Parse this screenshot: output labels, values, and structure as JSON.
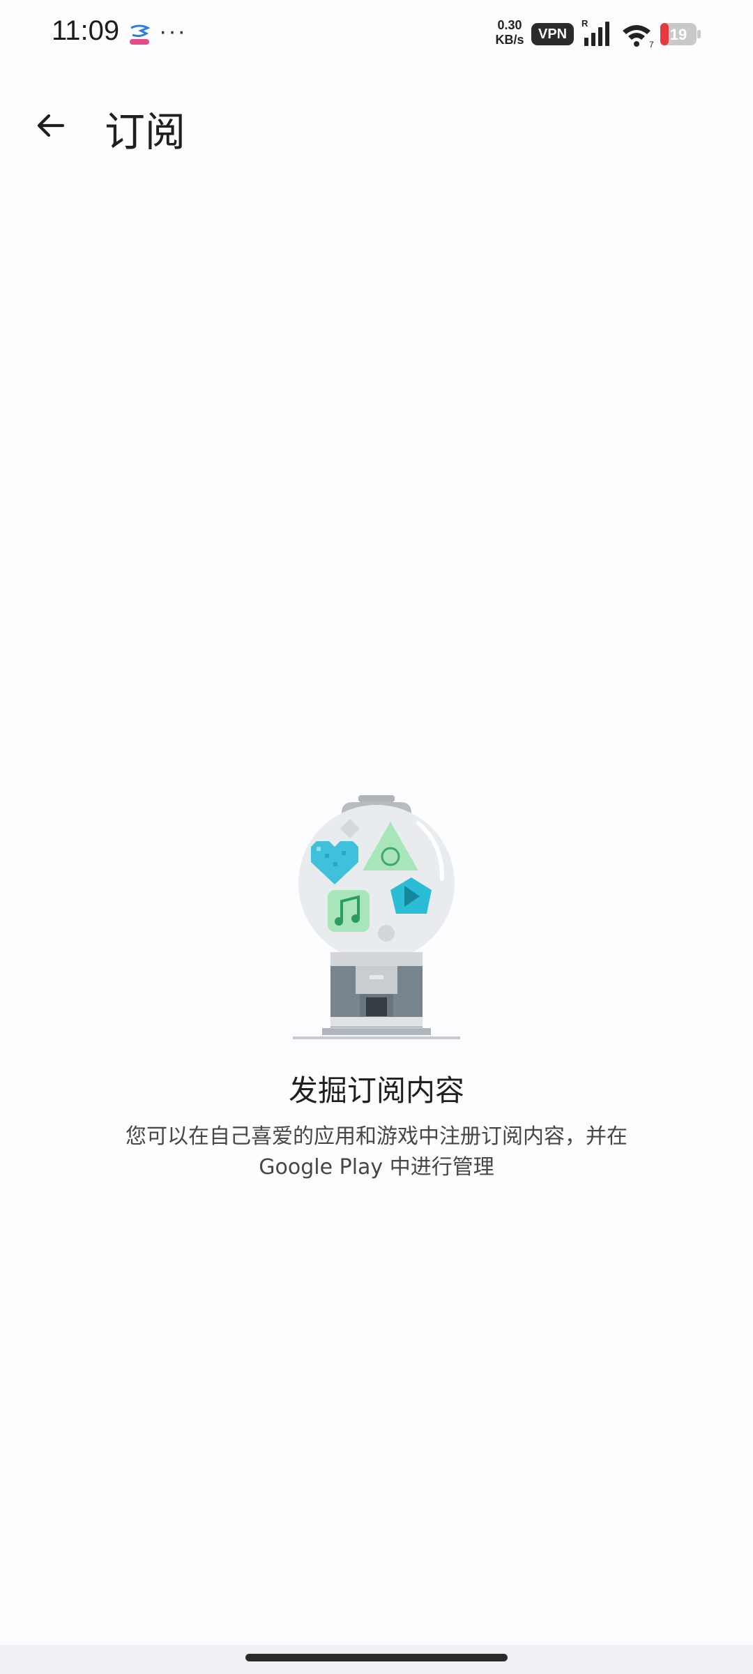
{
  "status_bar": {
    "time": "11:09",
    "more": "···",
    "net_speed_value": "0.30",
    "net_speed_unit": "KB/s",
    "vpn": "VPN",
    "signal_roaming": "R",
    "wifi_level": "7",
    "battery_level": "19",
    "battery_color": "#e5393e"
  },
  "app_bar": {
    "back_icon": "arrow-back-icon",
    "title": "订阅"
  },
  "empty_state": {
    "illustration": "gumball-machine-illustration",
    "title": "发掘订阅内容",
    "description": "您可以在自己喜爱的应用和游戏中注册订阅内容，并在 Google Play 中进行管理"
  },
  "colors": {
    "background": "#fdfcff",
    "heart": "#3fc1dc",
    "triangle": "#a8e6b9",
    "music_tile": "#a8e6b9",
    "pentagon": "#2bbcd6"
  }
}
